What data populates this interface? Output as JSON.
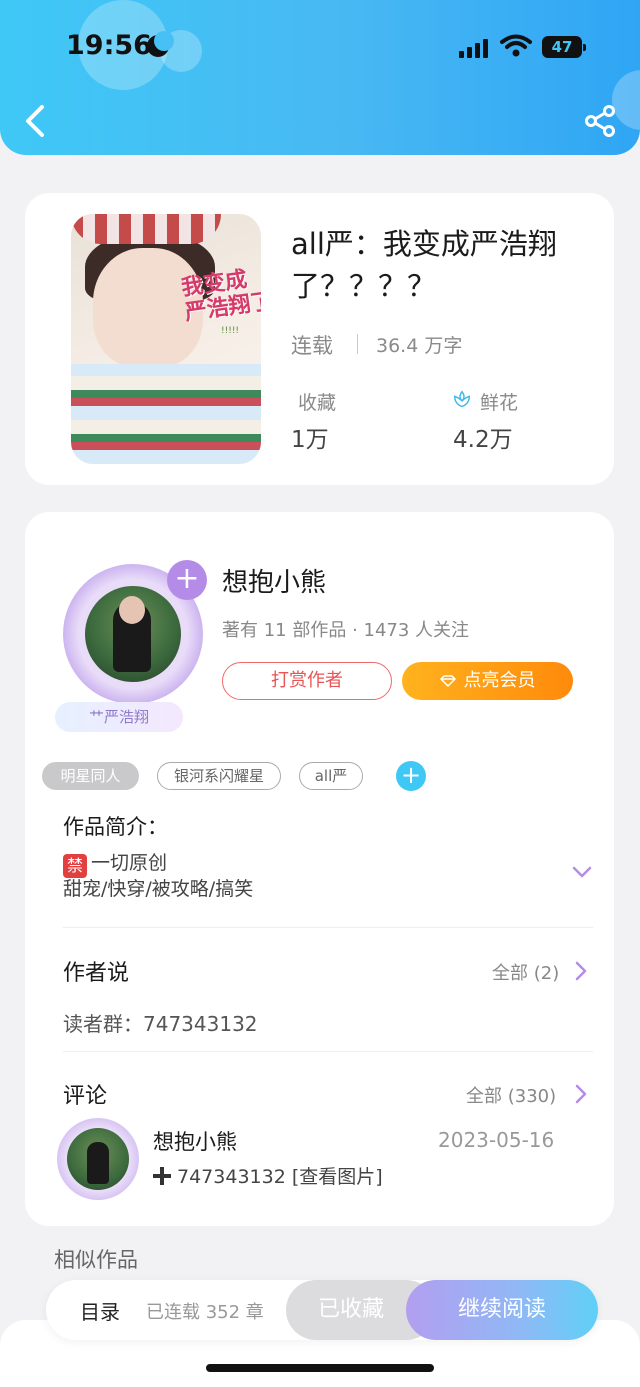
{
  "status_bar": {
    "time": "19:56",
    "battery": "47"
  },
  "book": {
    "title": "all严：我变成严浩翔了？？？？",
    "status": "连载",
    "word_count": "36.4 万字",
    "fav_label": "收藏",
    "fav_value": "1万",
    "flower_label": "鲜花",
    "flower_value": "4.2万",
    "cover_title": "我变成\n严浩翔了",
    "cover_marks": "!!!!!"
  },
  "author": {
    "name": "想抱小熊",
    "info": "著有 11 部作品 · 1473 人关注",
    "tip_button": "打赏作者",
    "vip_button": "点亮会员",
    "badge": "艹严浩翔"
  },
  "tags": [
    "明星同人",
    "银河系闪耀星",
    "all严"
  ],
  "intro": {
    "title": "作品简介：",
    "ban_icon": "禁",
    "line1": "一切原创",
    "line2": "甜宠/快穿/被攻略/搞笑"
  },
  "author_says": {
    "title": "作者说",
    "more": "全部 (2)",
    "content": "读者群：747343132"
  },
  "comments": {
    "title": "评论",
    "more": "全部 (330)",
    "item": {
      "name": "想抱小熊",
      "date": "2023-05-16",
      "text": "747343132 [查看图片]"
    }
  },
  "similar_title": "相似作品",
  "bottom_bar": {
    "toc": "目录",
    "chapters": "已连载 352 章",
    "fav_button": "已收藏",
    "read_button": "继续阅读"
  },
  "colors": {
    "accent": "#3fc8f6",
    "vip": "#ff9a12",
    "tip": "#e85454",
    "purple": "#b58be8"
  }
}
